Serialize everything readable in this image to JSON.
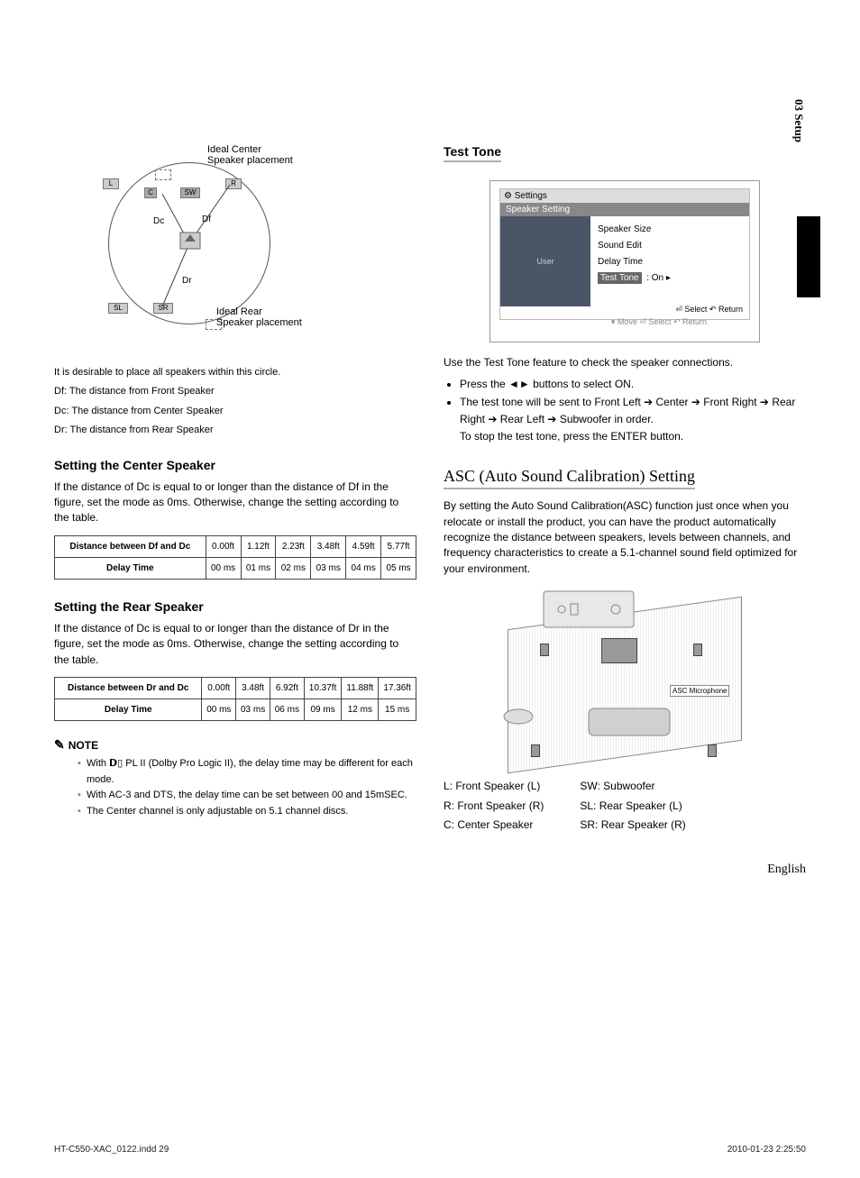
{
  "sideTab": "03   Setup",
  "diagram": {
    "idealCenter": "Ideal Center\nSpeaker placement",
    "idealRear": "Ideal Rear\nSpeaker placement",
    "L": "L",
    "R": "R",
    "C": "C",
    "SW": "SW",
    "SL": "SL",
    "SR": "SR",
    "Dc": "Dc",
    "Df": "Df",
    "Dr": "Dr"
  },
  "caption": {
    "line1": "It is desirable to place all speakers within this circle.",
    "df": "Df: The distance from Front Speaker",
    "dc": "Dc: The distance from Center Speaker",
    "dr": "Dr: The distance from Rear Speaker"
  },
  "centerSpeaker": {
    "heading": "Setting the Center Speaker",
    "body": "If the distance of Dc is equal to or longer than the distance of Df in the figure, set the mode as 0ms. Otherwise, change the setting according to the table.",
    "rowDistLabel": "Distance between Df and Dc",
    "dist": [
      "0.00ft",
      "1.12ft",
      "2.23ft",
      "3.48ft",
      "4.59ft",
      "5.77ft"
    ],
    "rowDelayLabel": "Delay Time",
    "delay": [
      "00 ms",
      "01 ms",
      "02 ms",
      "03 ms",
      "04 ms",
      "05 ms"
    ]
  },
  "rearSpeaker": {
    "heading": "Setting the Rear Speaker",
    "body": "If the distance of Dc is equal to or longer than the distance of Dr in the figure, set the mode as 0ms. Otherwise, change the setting according to the table.",
    "rowDistLabel": "Distance between Dr and Dc",
    "dist": [
      "0.00ft",
      "3.48ft",
      "6.92ft",
      "10.37ft",
      "11.88ft",
      "17.36ft"
    ],
    "rowDelayLabel": "Delay Time",
    "delay": [
      "00 ms",
      "03 ms",
      "06 ms",
      "09 ms",
      "12 ms",
      "15 ms"
    ]
  },
  "note": {
    "head": "NOTE",
    "items": [
      "With 𝗗▯ PL II (Dolby Pro Logic II), the delay time may be different for each mode.",
      "With AC-3 and DTS, the delay time can be set between 00 and 15mSEC.",
      "The Center channel is only adjustable on 5.1 channel discs."
    ]
  },
  "testTone": {
    "heading": "Test Tone",
    "osd": {
      "settings": "Settings",
      "title": "Speaker Setting",
      "items": [
        "Speaker Size",
        "Sound Edit",
        "Delay Time"
      ],
      "activeLabel": "Test Tone",
      "activeValue": ":  On   ▸",
      "sideLabel": "User",
      "footSelect": "⏎ Select    ↶ Return",
      "footMove": "▾ Move     ⏎ Select     ↶ Return"
    },
    "body": "Use the Test Tone feature to check the speaker connections.",
    "steps": [
      "Press the ◄► buttons to select ON.",
      "The test tone will be sent to Front Left ➔ Center ➔ Front Right ➔ Rear Right ➔ Rear Left ➔ Subwoofer in order.\nTo stop the test tone, press the ENTER button."
    ]
  },
  "asc": {
    "heading": "ASC (Auto Sound Calibration) Setting",
    "body": "By setting the Auto Sound Calibration(ASC) function just once when you relocate or install the product, you can have the product automatically recognize the distance between speakers, levels between channels, and frequency characteristics to create a 5.1-channel sound field optimized for your environment.",
    "micLabel": "ASC Microphone",
    "legendLeft": [
      "L: Front Speaker (L)",
      "R: Front Speaker (R)",
      "C: Center Speaker"
    ],
    "legendRight": [
      "SW: Subwoofer",
      "SL: Rear Speaker (L)",
      "SR: Rear Speaker (R)"
    ]
  },
  "language": "English",
  "footerLeft": "HT-C550-XAC_0122.indd   29",
  "footerRight": "2010-01-23   2:25:50"
}
